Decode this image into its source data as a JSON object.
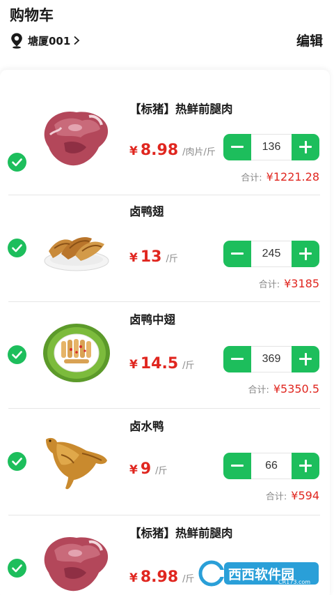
{
  "header": {
    "title": "购物车",
    "location": "塘厦001",
    "edit_label": "编辑"
  },
  "cart": {
    "currency_symbol": "¥",
    "total_label": "合计:",
    "items": [
      {
        "name": "【标猪】热鲜前腿肉",
        "price": "8.98",
        "unit": "/肉片/斤",
        "quantity": "136",
        "total": "¥1221.28",
        "image": "pork-leg"
      },
      {
        "name": "卤鸭翅",
        "price": "13",
        "unit": "/斤",
        "quantity": "245",
        "total": "¥3185",
        "image": "braised-duck-wing"
      },
      {
        "name": "卤鸭中翅",
        "price": "14.5",
        "unit": "/斤",
        "quantity": "369",
        "total": "¥5350.5",
        "image": "braised-duck-mid-wing"
      },
      {
        "name": "卤水鸭",
        "price": "9",
        "unit": "/斤",
        "quantity": "66",
        "total": "¥594",
        "image": "braised-duck"
      },
      {
        "name": "【标猪】热鲜前腿肉",
        "price": "8.98",
        "unit": "/斤",
        "image": "pork-leg"
      }
    ]
  },
  "watermark": {
    "text": "西西软件园",
    "sub": "CR173.com"
  },
  "colors": {
    "accent_green": "#1dbe5c",
    "price_red": "#e0261f"
  }
}
